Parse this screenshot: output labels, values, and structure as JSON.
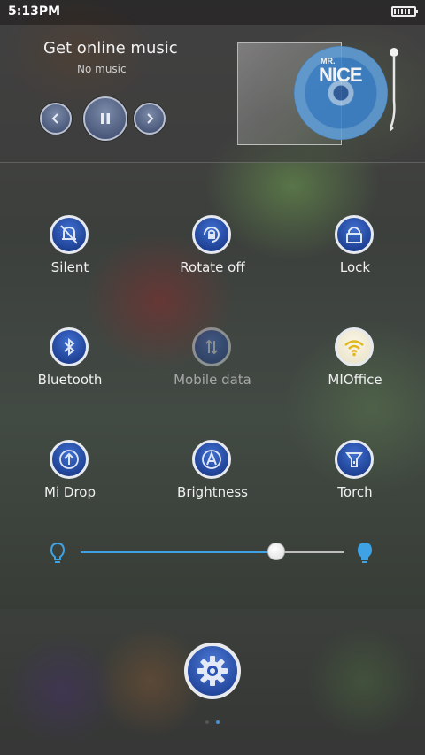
{
  "status_bar": {
    "time": "5:13PM",
    "battery_icon": "battery-full-icon"
  },
  "music": {
    "title": "Get online music",
    "subtitle": "No music",
    "album_art_text": "NICE",
    "album_art_small_text": "MR.",
    "controls": [
      "previous-icon",
      "pause-icon",
      "next-icon"
    ]
  },
  "toggles": [
    {
      "label": "Silent",
      "icon": "bell-off-icon",
      "state": "off"
    },
    {
      "label": "Rotate off",
      "icon": "rotate-lock-icon",
      "state": "off"
    },
    {
      "label": "Lock",
      "icon": "lock-icon",
      "state": "off"
    },
    {
      "label": "Bluetooth",
      "icon": "bluetooth-icon",
      "state": "off"
    },
    {
      "label": "Mobile data",
      "icon": "mobile-data-icon",
      "state": "disabled"
    },
    {
      "label": "MIOffice",
      "icon": "wifi-icon",
      "state": "on"
    },
    {
      "label": "Mi Drop",
      "icon": "mi-drop-icon",
      "state": "off"
    },
    {
      "label": "Brightness",
      "icon": "brightness-auto-icon",
      "state": "off"
    },
    {
      "label": "Torch",
      "icon": "torch-icon",
      "state": "off"
    }
  ],
  "brightness_slider": {
    "value": 0.74,
    "min_icon": "bulb-dim-icon",
    "max_icon": "bulb-bright-icon"
  },
  "bottom": {
    "settings_icon": "gear-icon",
    "page_count": 2,
    "active_page": 1
  },
  "colors": {
    "accent": "#3fa2e5",
    "toggle_blue": "#2a52b4",
    "wifi_on": "#e3b619"
  }
}
